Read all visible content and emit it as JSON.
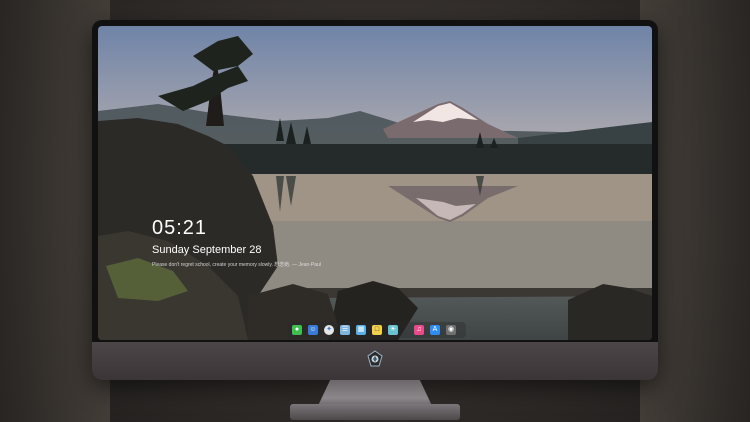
{
  "lockscreen": {
    "time": "05:21",
    "date": "Sunday September  28",
    "quote": "Please don't regret school, create your memory slowly. 想念她. — Jean-Paul"
  },
  "dock": {
    "icons": [
      "messages-icon",
      "finder-icon",
      "safari-icon",
      "notes-icon",
      "files-icon",
      "calendar-icon",
      "photos-icon",
      "music-icon",
      "app-store-icon",
      "camera-icon"
    ]
  },
  "colors": {
    "bezel": "#111111",
    "chin": "#3f393b",
    "sky_top": "#6f84a8",
    "sky_horizon": "#d9b895"
  }
}
